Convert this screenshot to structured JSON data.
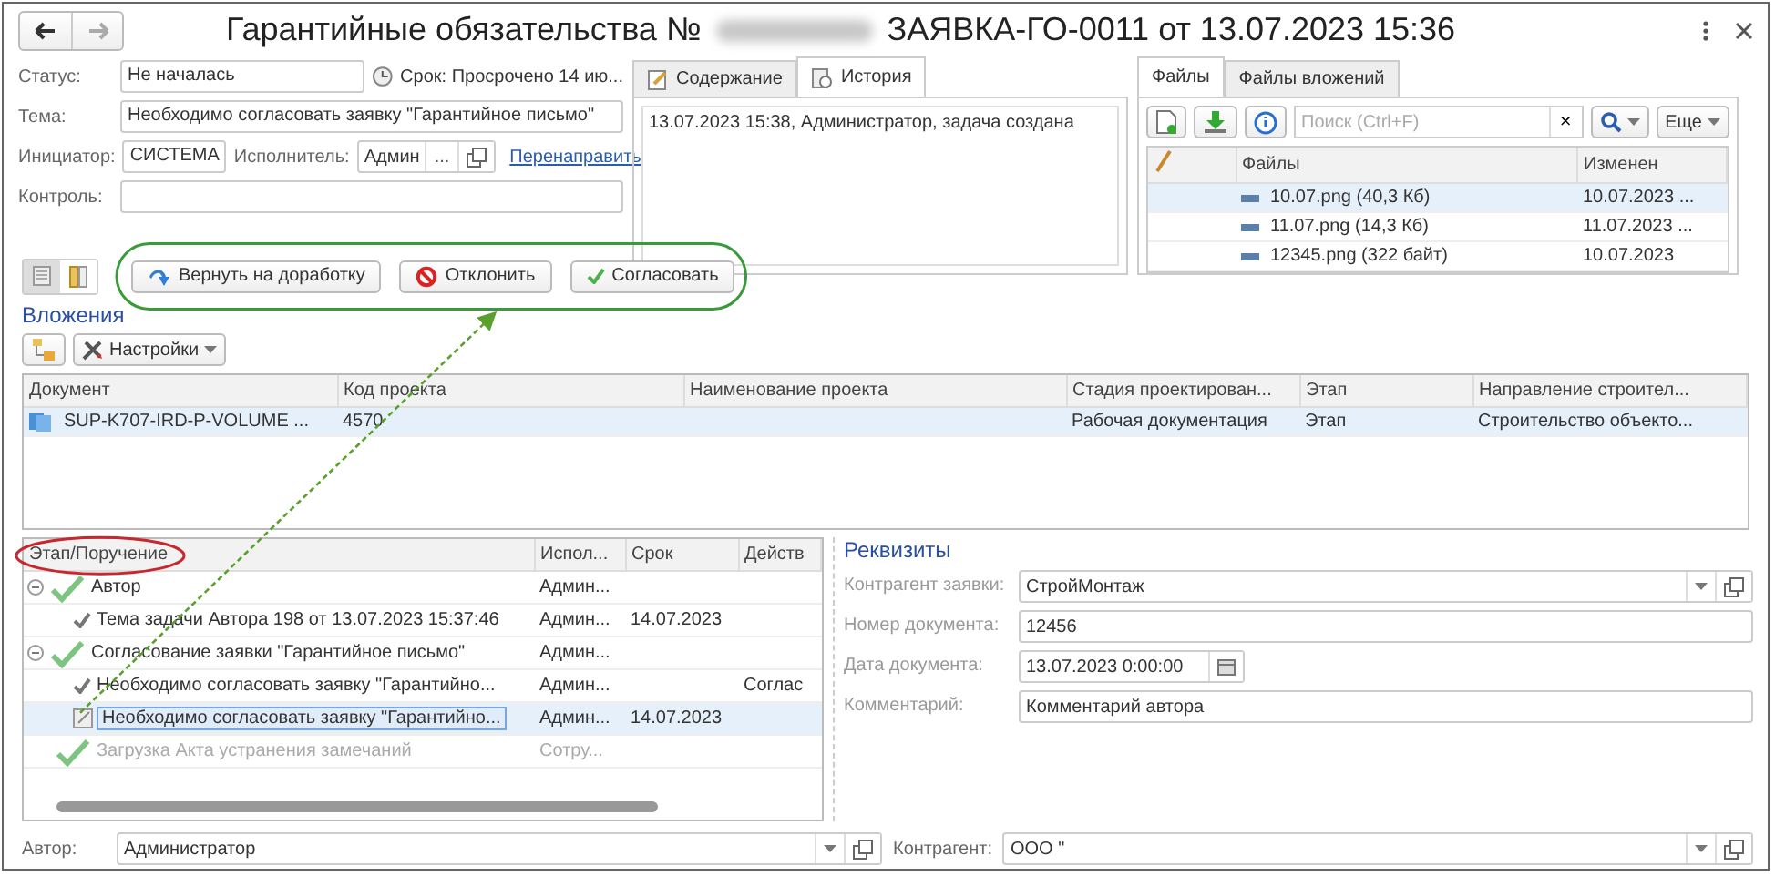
{
  "window": {
    "title_prefix": "Гарантийные обязательства №",
    "title_suffix": "ЗАЯВКА-ГО-0011 от 13.07.2023 15:36"
  },
  "form": {
    "status_label": "Статус:",
    "status": "Не началась",
    "deadline": "Срок: Просрочено 14 ию...",
    "topic_label": "Тема:",
    "topic": "Необходимо согласовать заявку \"Гарантийное письмо\"",
    "initiator_label": "Инициатор:",
    "initiator": "СИСТЕМА",
    "executor_label": "Исполнитель:",
    "executor": "Админ",
    "choose_button": "...",
    "redirect_link": "Перенаправить",
    "control_label": "Контроль:"
  },
  "history": {
    "tabs": [
      {
        "label": "Содержание",
        "selected": false
      },
      {
        "label": "История",
        "selected": true
      }
    ],
    "entries": [
      "13.07.2023 15:38, Администратор, задача создана"
    ]
  },
  "files": {
    "tabs": [
      {
        "label": "Файлы",
        "selected": true
      },
      {
        "label": "Файлы вложений",
        "selected": false
      }
    ],
    "search": {
      "placeholder": "Поиск (Ctrl+F)"
    },
    "clear": "×",
    "more": "Еще",
    "columns": [
      "Файлы",
      "Изменен"
    ],
    "rows": [
      {
        "name": "10.07.png (40,3 Кб)",
        "modified": "10.07.2023 ...",
        "selected": true
      },
      {
        "name": "11.07.png (14,3 Кб)",
        "modified": "11.07.2023 ...",
        "selected": false
      },
      {
        "name": "12345.png (322 байт)",
        "modified": "10.07.2023",
        "selected": false
      }
    ]
  },
  "view_toggles": [
    {
      "kind": "list",
      "selected": true
    },
    {
      "kind": "split",
      "selected": false
    }
  ],
  "actions": [
    {
      "label": "Вернуть на доработку",
      "kind": "return"
    },
    {
      "label": "Отклонить",
      "kind": "reject"
    },
    {
      "label": "Согласовать",
      "kind": "approve"
    }
  ],
  "attachments": {
    "title": "Вложения",
    "settings": "Настройки",
    "columns": [
      "Документ",
      "Код проекта",
      "Наименование проекта",
      "Стадия проектирован...",
      "Этап",
      "Направление строител..."
    ],
    "rows": [
      {
        "cells": [
          "SUP-K707-IRD-P-VOLUME ...",
          "4570",
          "",
          "Рабочая документация",
          "Этап",
          "Строительство объекто..."
        ],
        "selected": true
      }
    ]
  },
  "tree": {
    "columns": [
      "Этап/Поручение",
      "Испол...",
      "Срок",
      "Действ"
    ],
    "items": [
      {
        "cells": [
          "Автор",
          "Админ...",
          "",
          ""
        ],
        "kind": "stage",
        "expanded": true,
        "inactive": false,
        "selected": false,
        "children": [
          {
            "cells": [
              "Тема задачи Автора 198 от 13.07.2023 15:37:46",
              "Админ...",
              "14.07.2023",
              ""
            ],
            "kind": "completed",
            "inactive": false,
            "selected": false
          }
        ]
      },
      {
        "cells": [
          "Согласование заявки \"Гарантийное письмо\"",
          "Админ...",
          "",
          ""
        ],
        "kind": "stage",
        "expanded": true,
        "inactive": false,
        "selected": false,
        "children": [
          {
            "cells": [
              "Необходимо согласовать заявку \"Гарантийно...",
              "Админ...",
              "",
              "Соглас"
            ],
            "kind": "completed",
            "inactive": false,
            "selected": false
          },
          {
            "cells": [
              "Необходимо согласовать заявку \"Гарантийно...",
              "Админ...",
              "14.07.2023",
              ""
            ],
            "kind": "current",
            "inactive": false,
            "selected": true
          }
        ]
      },
      {
        "cells": [
          "Загрузка Акта устранения замечаний",
          "Сотру...",
          "",
          ""
        ],
        "kind": "stage",
        "inactive": true,
        "selected": false
      }
    ]
  },
  "requisites": {
    "title": "Реквизиты",
    "fields": [
      {
        "label": "Контрагент заявки:",
        "value": "СтройМонтаж",
        "kind": "select"
      },
      {
        "label": "Номер документа:",
        "value": "12456",
        "kind": "text"
      },
      {
        "label": "Дата документа:",
        "value": "13.07.2023  0:00:00",
        "kind": "date"
      },
      {
        "label": "Комментарий:",
        "value": "Комментарий автора",
        "kind": "text"
      }
    ]
  },
  "footer": {
    "author_label": "Автор:",
    "author": "Администратор",
    "counterparty_label": "Контрагент:",
    "counterparty": "ООО \""
  }
}
